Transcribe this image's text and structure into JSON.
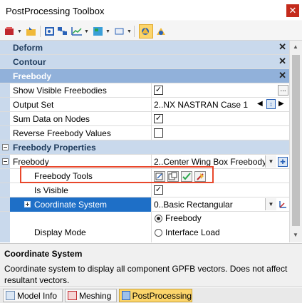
{
  "window": {
    "title": "PostProcessing Toolbox",
    "close_glyph": "✕"
  },
  "toolbar": {
    "icons": [
      "postprocess-icon",
      "open-icon",
      "mesh-icon",
      "group-icon",
      "chart-icon",
      "view-icon",
      "select-icon",
      "freebody-icon",
      "color-icon"
    ]
  },
  "grid": {
    "categories": {
      "deform": "Deform",
      "contour": "Contour",
      "freebody": "Freebody",
      "collapse_glyph": "✕"
    },
    "rows": {
      "show_visible": {
        "label": "Show Visible Freebodies",
        "checked": true,
        "ellipsis": "..."
      },
      "output_set": {
        "label": "Output Set",
        "value": "2..NX NASTRAN Case 1"
      },
      "sum_data": {
        "label": "Sum Data on Nodes",
        "checked": true
      },
      "reverse": {
        "label": "Reverse Freebody Values",
        "checked": false
      }
    },
    "freebody_properties": {
      "label": "Freebody Properties",
      "freebody": {
        "label": "Freebody",
        "value": "2..Center Wing Box Freebody"
      },
      "tools": {
        "label": "Freebody Tools"
      },
      "visible": {
        "label": "Is Visible",
        "checked": true
      },
      "coord": {
        "label": "Coordinate System",
        "value": "0..Basic Rectangular"
      },
      "display_mode": {
        "label": "Display Mode",
        "options": [
          "Freebody",
          "Interface Load"
        ],
        "selected": "Freebody"
      }
    }
  },
  "description": {
    "title": "Coordinate System",
    "text": "Coordinate system to display all component GPFB vectors. Does not affect resultant vectors."
  },
  "tabs": [
    {
      "label": "Model Info",
      "active": false
    },
    {
      "label": "Meshing",
      "active": false
    },
    {
      "label": "PostProcessing",
      "active": true
    }
  ],
  "colors": {
    "accent": "#1e6fc7",
    "category": "#c9d9ec",
    "highlight": "#e8472b",
    "active_tab": "#fcd56b"
  }
}
